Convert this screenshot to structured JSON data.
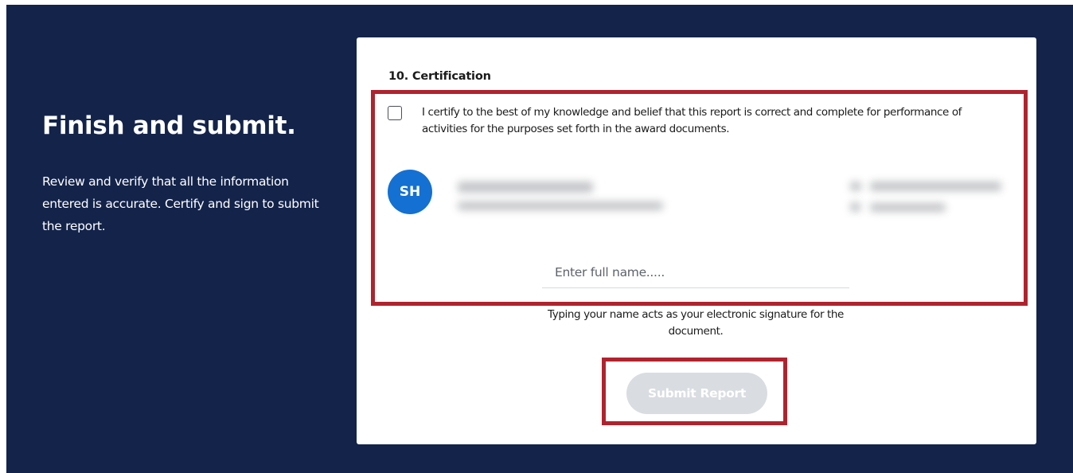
{
  "intro": {
    "title": "Finish and submit.",
    "description": "Review and verify that all the information entered is accurate. Certify and sign to submit the report."
  },
  "certification": {
    "section_title": "10. Certification",
    "checkbox_checked": false,
    "statement": "I certify to the best of my knowledge and belief that this report is correct and complete for performance of activities for the purposes set forth in the award documents.",
    "user": {
      "initials": "SH"
    },
    "name_input": {
      "placeholder": "Enter full name.....",
      "value": ""
    },
    "helper_text": "Typing your name acts as your electronic signature for the document.",
    "submit_label": "Submit Report"
  },
  "colors": {
    "background": "#13234a",
    "highlight": "#b0232e",
    "avatar": "#1470d2",
    "button_disabled": "#d9dce1"
  }
}
